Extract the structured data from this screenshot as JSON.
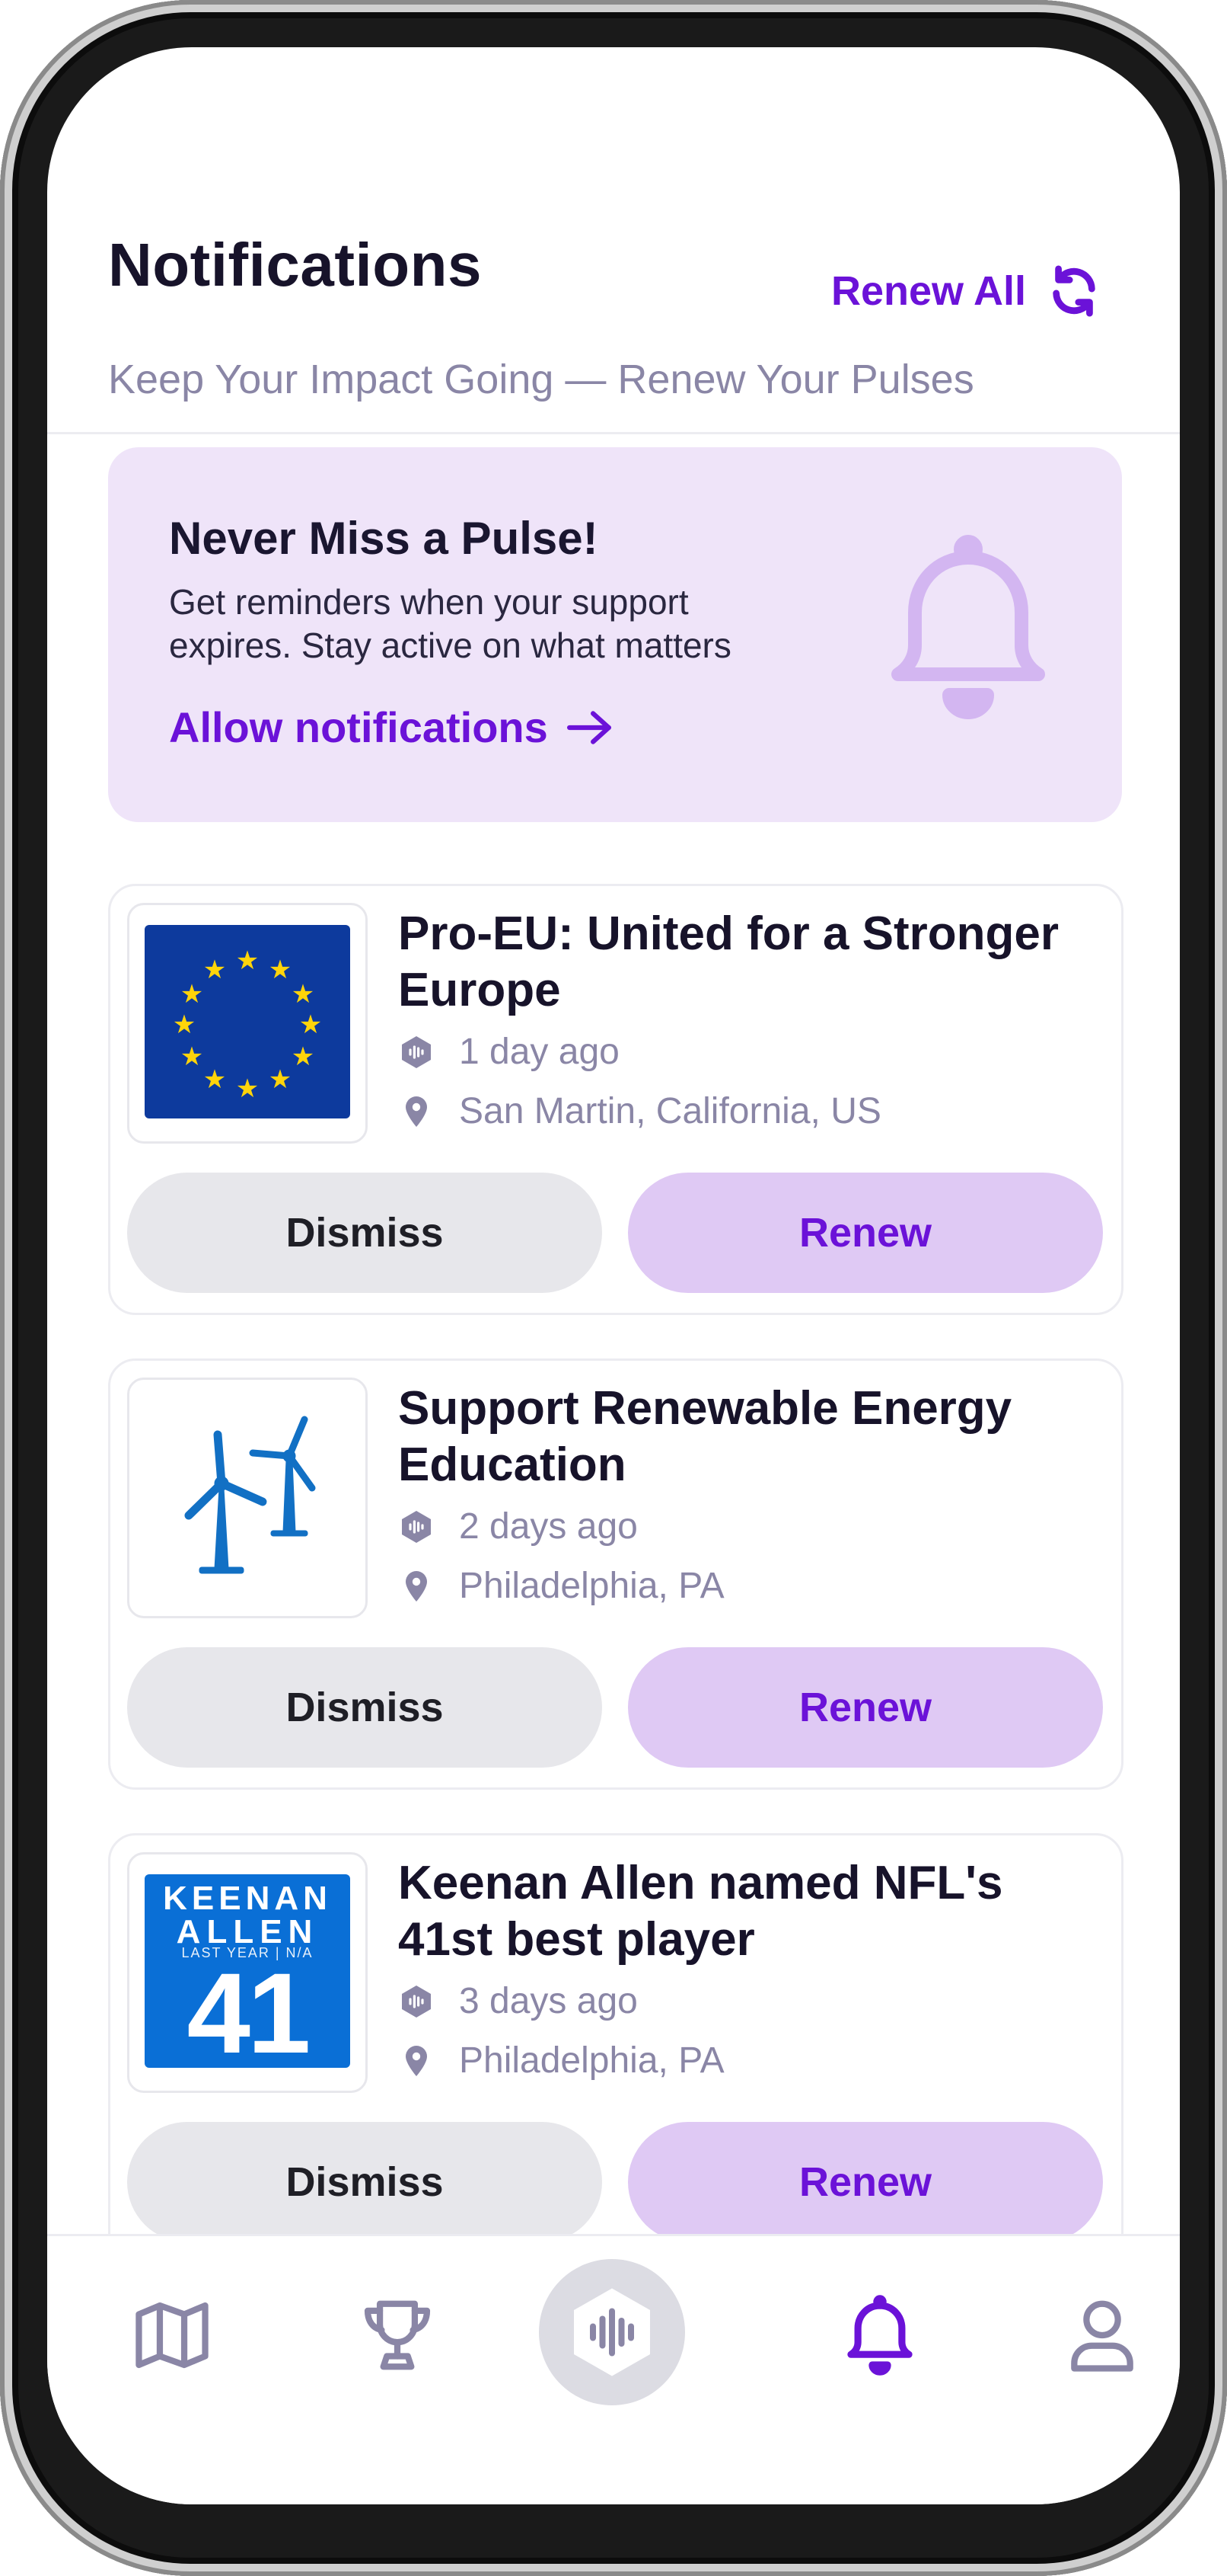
{
  "header": {
    "title": "Notifications",
    "renew_all_label": "Renew All",
    "subtitle": "Keep Your Impact Going — Renew Your Pulses"
  },
  "promo": {
    "title": "Never Miss a Pulse!",
    "text_line1": "Get reminders when your support",
    "text_line2": "expires. Stay active on what matters",
    "link_label": "Allow notifications"
  },
  "cards": [
    {
      "title_line1": "Pro-EU: United for a Stronger",
      "title_line2": "Europe",
      "time": "1 day ago",
      "location": "San Martin, California, US",
      "dismiss_label": "Dismiss",
      "renew_label": "Renew"
    },
    {
      "title_line1": "Support Renewable Energy",
      "title_line2": "Education",
      "time": "2 days ago",
      "location": "Philadelphia, PA",
      "dismiss_label": "Dismiss",
      "renew_label": "Renew"
    },
    {
      "title_line1": "Keenan Allen named NFL's",
      "title_line2": "41st best player",
      "time": "3 days ago",
      "location": "Philadelphia, PA",
      "dismiss_label": "Dismiss",
      "renew_label": "Renew",
      "thumb_text": {
        "first": "KEENAN",
        "last": "ALLEN",
        "sub": "LAST YEAR | N/A",
        "rank": "41"
      }
    }
  ],
  "tabbar": {
    "active": "notifications",
    "items": [
      "map",
      "trophy",
      "pulse",
      "notifications",
      "profile"
    ]
  },
  "colors": {
    "accent": "#6b12d8",
    "muted_text": "#8a86a6",
    "promo_bg": "#efe4f9",
    "renew_bg": "#dfc9f4",
    "dismiss_bg": "#e7e7eb"
  }
}
